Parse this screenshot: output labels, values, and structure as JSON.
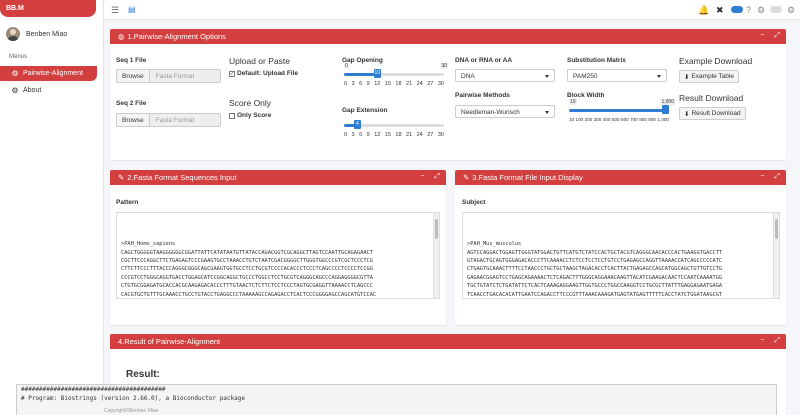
{
  "app": {
    "brand": "BB.M"
  },
  "user": {
    "name": "Benben Miao"
  },
  "sidebar": {
    "menus_label": "Menus",
    "items": [
      {
        "label": "Pairwise-Alignment",
        "icon": "gear-icon"
      },
      {
        "label": "About",
        "icon": "cog-icon"
      }
    ]
  },
  "panel1": {
    "title": "1.Pairwise-Alignment Options",
    "seq1_label": "Seq 1 File",
    "seq2_label": "Seq 2 File",
    "browse_label": "Browse",
    "seq1_placeholder": "Fasta Format",
    "seq2_placeholder": "Fasta Format",
    "upload_or_paste": "Upload or Paste",
    "default_upload": "Default: Upload File",
    "score_only_title": "Score Only",
    "only_score": "Only Score",
    "gap_opening": {
      "label": "Gap Opening",
      "min": "0",
      "max": "30",
      "value": 10,
      "value_label": "10",
      "ticks": [
        "0",
        "3",
        "6",
        "9",
        "12",
        "15",
        "18",
        "21",
        "24",
        "27",
        "30"
      ]
    },
    "gap_extension": {
      "label": "Gap Extension",
      "min": "0",
      "max": "30",
      "value": 4,
      "value_label": "4",
      "ticks": [
        "0",
        "3",
        "6",
        "9",
        "12",
        "15",
        "18",
        "21",
        "24",
        "27",
        "30"
      ]
    },
    "dna_rna_aa": {
      "label": "DNA or RNA or AA",
      "value": "DNA"
    },
    "pairwise_methods": {
      "label": "Pairwise Methods",
      "value": "Needleman-Wunsch"
    },
    "substitution_matrix": {
      "label": "Substitution Matrix",
      "value": "PAM250"
    },
    "block_width": {
      "label": "Block Width",
      "min": "10",
      "max": "1,000",
      "value": 1000,
      "ticks": [
        "10",
        "100",
        "200",
        "300",
        "400",
        "500",
        "600",
        "700",
        "800",
        "900",
        "1,000"
      ]
    },
    "example_download": "Example Download",
    "example_table": "Example Table",
    "result_download": "Result Download",
    "result_button": "Result Download"
  },
  "panel2": {
    "title": "2.Fasta Format Sequences Input",
    "pattern_label": "Pattern",
    "lines": [
      ">PAH_Homo_sapiens",
      "CAGCTGGGGGTAAGGGGGGCGGATTATTCATATAATGTTATACCAGACGGTCGCAGGCTTAGTCCAATTGCAGAGAACT",
      "CGCTTCCCAGGCTTCTGAGAGTCCCGAAGTGCCTAAACCTGTCTAATCGACGGGGCTTGGGTGGCCCGTCGCTCCCTCG",
      "CTTCTTCCCTTTACCCAGGGCGGGCAGCGAAGTGGTGCCTCCTGCGTCCCCACACCCTCCCTCAGCCCCTCCCCTCCGG",
      "CCCGTCCTGGGCAGGTGACCTGGAGCATCCGGCAGGCTGCCCTGGCCTCCTGCGTCAGGGCAGCCCAGGAGGGGCGTTA",
      "CTGTGCGGAGATGCACCACGCAAGAGACACCCTTTGTAACTCTCTTCTCCTCCCTAGTGCGAGGTTAAAACCTCAGCCC",
      "CACGTGCTGTTTGCAAACCTGCCTGTACCTGAGGCCCTAAAAAGCCAGAGACCTCACTCCCGGGGAGCCAGCATGTCCAC",
      "TGCGGTCCTGGAAAACCCAGGCTTGGGCAGGAAACTCTCTGACTTTGGACAGGAAACAAGCTATATTGAAGACAACTGCA",
      "ATCAAAATGGTGCCATATCACTGATCTTCTCACTCAAAGAAGAAGTTGGTGCATTGGCCAAAGTATTGCGCTTATTTGAG",
      "GAGAATGATGTAAACCTGACCCACATTGAATCTAGACCTTCTCGTTTAAAGAAAGATGAGTATGAATTTTTCACCCATTT"
    ]
  },
  "panel3": {
    "title": "3.Fasta Format File Input Display",
    "subject_label": "Subject",
    "lines": [
      ">PAH_Mus_musculus",
      "AGTCCAGGACTGGAGTTGGGTATGGACTGTTCATGTCTATCCACTGCTACGTCAGGGCAACACCCACTGAAGGTGACCTT",
      "GTAGACTGCAGTGGGAGACACCCTTCAAAACCTCTCCTCCTCCTGTCCTGAGAGCCAGGTTAAAACCATCAGCCCCCATC",
      "CTGAGTGCAAACTTTTCCTAACCCTGCTGCTAAGCTAGACACCTCACTTACTGAGAGCCAGCATGGCAGCTGTTGTCCTG",
      "GAGAACGGAGTCCTGAGCAGAAAACTCTCAGACTTTGGGCAGGAAACAAGTTACATCGAAGACAACTCCAATCAAAATGG",
      "TGCTGTATCTCTGATATTCTCACTCAAAGAGGAAGTTGGTGCCCTGGCCAAGGTCCTGCGCTTATTTGAGGAGAATGAGA",
      "TCAACCTGACACACATTGAATCCAGACCTTCCCGTTTAAACAAAGATGAGTATGAGTTTTTCACCTATCTGGATAAGCGT",
      "AGCAAGCCCGTCCTGGGCAGCATCATCAAGAGCCTGAGGAACGACATTGGTGCCACTGTCCATGAGCTTTCCCGAGACAA",
      "GGAAAAGAACACAGTGCCCTGGTTCCCAAGGACCATTCAGGAGCTGGACAGATTCGCCAATCAGATTCTCAGCTATGGAG",
      "CCGAACTGGATGCAGACCACCCAGGCTTTAAAGATCCTGTGTACCGGGCGAGACGAAAGCAGTTTGCTGACATTGCCTAC"
    ]
  },
  "panel4": {
    "title": "4.Result of Pairwise-Alignment",
    "result_title": "Result:",
    "lines": [
      "########################################",
      "# Program: Biostrings (version 2.66.0), a Bioconductor package"
    ]
  },
  "footer": {
    "text": "Copyright©Benben Miao"
  }
}
